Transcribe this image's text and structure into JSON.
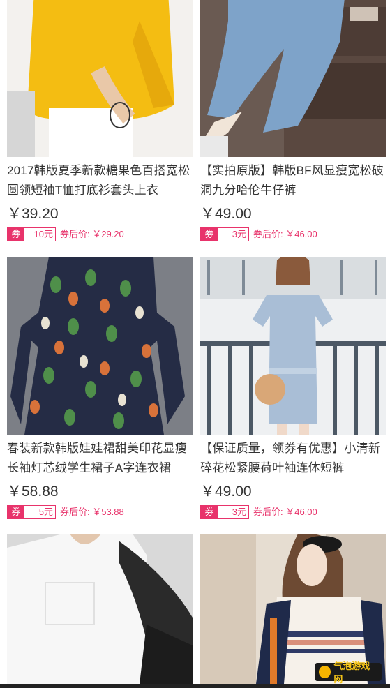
{
  "products": [
    {
      "title": "2017韩版夏季新款糖果色百搭宽松圆领短袖T恤打底衫套头上衣",
      "price": "￥39.20",
      "coupon_tag": "券",
      "coupon_amount": "10元",
      "after_coupon": "券后价: ￥29.20"
    },
    {
      "title": "【实拍原版】韩版BF风显瘦宽松破洞九分哈伦牛仔裤",
      "price": "￥49.00",
      "coupon_tag": "券",
      "coupon_amount": "3元",
      "after_coupon": "券后价: ￥46.00"
    },
    {
      "title": "春装新款韩版娃娃裙甜美印花显瘦长袖灯芯绒学生裙子A字连衣裙",
      "price": "￥58.88",
      "coupon_tag": "券",
      "coupon_amount": "5元",
      "after_coupon": "券后价: ￥53.88"
    },
    {
      "title": "【保证质量，领券有优惠】小清新碎花松紧腰荷叶袖连体短裤",
      "price": "￥49.00",
      "coupon_tag": "券",
      "coupon_amount": "3元",
      "after_coupon": "券后价: ￥46.00"
    },
    {
      "title": ""
    },
    {
      "title": ""
    }
  ],
  "watermark": {
    "text": "气泡游戏网"
  },
  "colors": {
    "accent": "#e8336b",
    "text": "#333333"
  }
}
